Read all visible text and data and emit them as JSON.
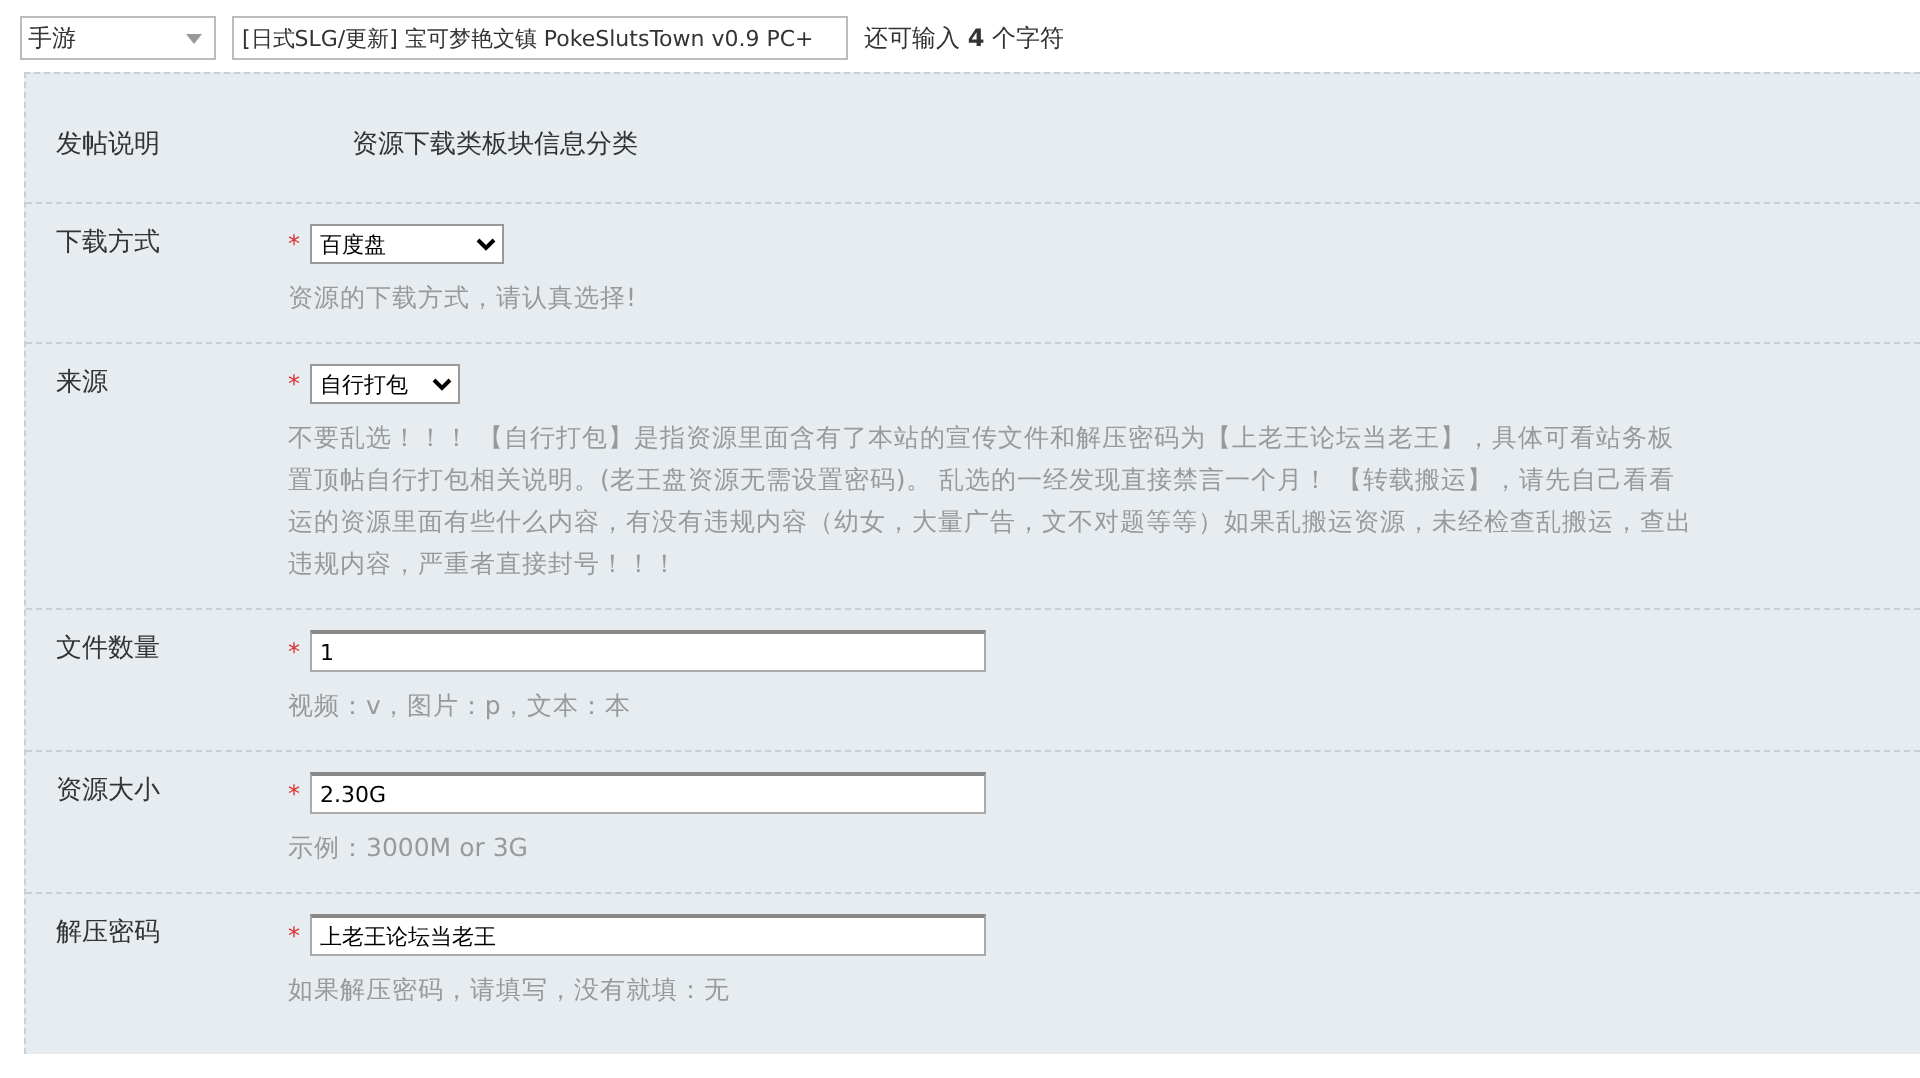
{
  "top_bar": {
    "category_select": {
      "value": "手游"
    },
    "title_field": {
      "value": "[日式SLG/更新] 宝可梦艳文镇 PokeSlutsTown v0.9 PC+"
    },
    "char_counter": "还可输入 **4** 个字符"
  },
  "form": {
    "header": {
      "label": "发帖说明",
      "text": "资源下载类板块信息分类"
    },
    "rows": [
      {
        "label": "下载方式",
        "kind": "select",
        "required_mark": "*",
        "value": "百度盘",
        "hint_lines": [
          "资源的下载方式，请认真选择!"
        ]
      },
      {
        "label": "来源",
        "kind": "select",
        "required_mark": "*",
        "value": "自行打包",
        "hint_lines": [
          "不要乱选！！！ 【自行打包】是指资源里面含有了本站的宣传文件和解压密码为【上老王论坛当老王】，具体可看站务板",
          "置顶帖自行打包相关说明。(老王盘资源无需设置密码)。 乱选的一经发现直接禁言一个月！ 【转载搬运】，请先自己看看",
          "运的资源里面有些什么内容，有没有违规内容（幼女，大量广告，文不对题等等）如果乱搬运资源，未经检查乱搬运，查出",
          "违规内容，严重者直接封号！！！"
        ]
      },
      {
        "label": "文件数量",
        "kind": "text",
        "required_mark": "*",
        "value": "1",
        "hint_lines": [
          "视频：v，图片：p，文本：本"
        ]
      },
      {
        "label": "资源大小",
        "kind": "text",
        "required_mark": "*",
        "value": "2.30G",
        "hint_lines": [
          "示例：3000M or 3G"
        ]
      },
      {
        "label": "解压密码",
        "kind": "text",
        "required_mark": "*",
        "value": "上老王论坛当老王",
        "hint_lines": [
          "如果解压密码，请填写，没有就填：无"
        ]
      }
    ]
  }
}
